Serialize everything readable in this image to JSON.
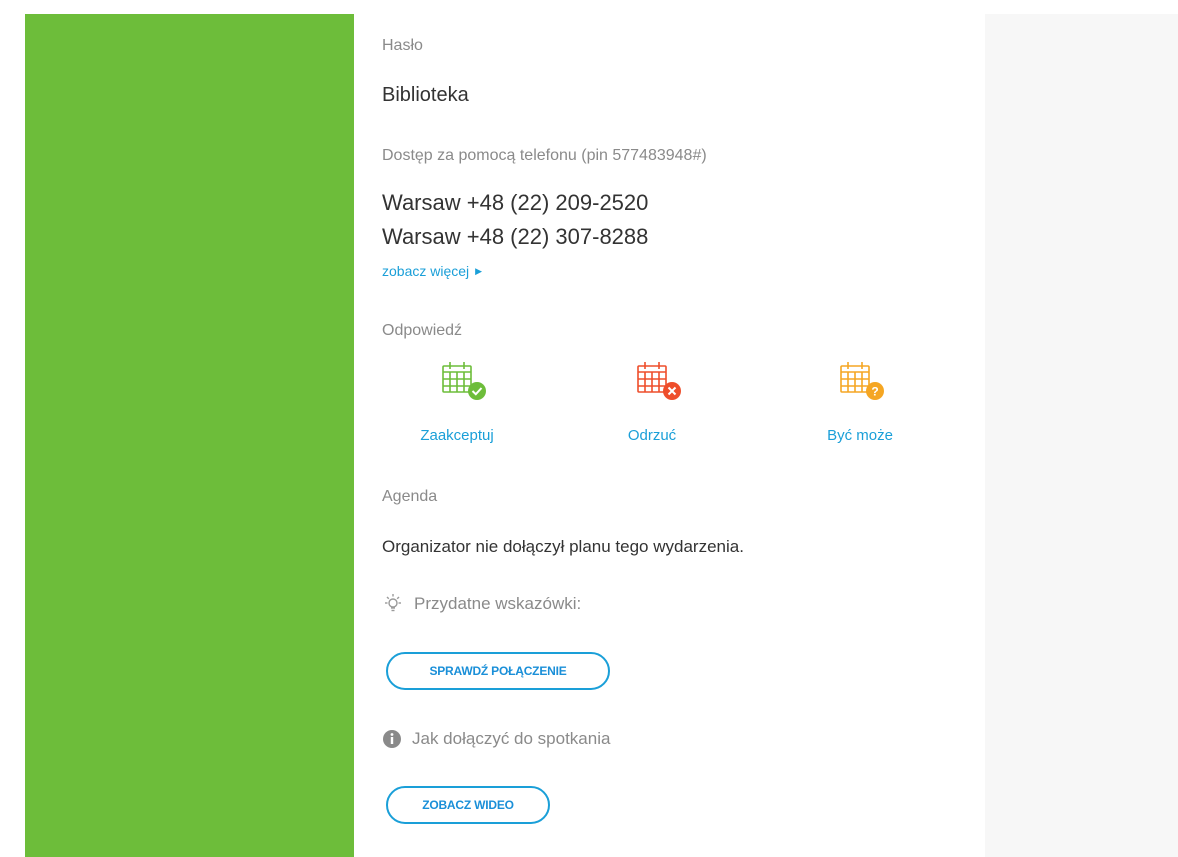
{
  "password": {
    "label": "Hasło",
    "value": "Biblioteka"
  },
  "phone_access": {
    "label": "Dostęp za pomocą telefonu (pin 577483948#)",
    "numbers": [
      "Warsaw +48 (22) 209-2520",
      "Warsaw +48 (22) 307-8288"
    ],
    "more_link": "zobacz więcej",
    "more_icon": "triangle-right-icon"
  },
  "response": {
    "label": "Odpowiedź",
    "options": [
      {
        "label": "Zaakceptuj",
        "icon": "calendar-accept-icon",
        "color": "#6dbd3a"
      },
      {
        "label": "Odrzuć",
        "icon": "calendar-decline-icon",
        "color": "#ee4e2b"
      },
      {
        "label": "Być może",
        "icon": "calendar-maybe-icon",
        "color": "#f5a623"
      }
    ]
  },
  "agenda": {
    "label": "Agenda",
    "text": "Organizator nie dołączył planu tego wydarzenia."
  },
  "tips": {
    "label": "Przydatne wskazówki:",
    "icon": "lightbulb-icon",
    "check_button": "SPRAWDŹ POŁĄCZENIE"
  },
  "join_help": {
    "label": "Jak dołączyć do spotkania",
    "icon": "info-icon",
    "video_button": "ZOBACZ WIDEO"
  },
  "colors": {
    "accent": "#1a9fd8",
    "sidebar": "#6dbd3a"
  }
}
